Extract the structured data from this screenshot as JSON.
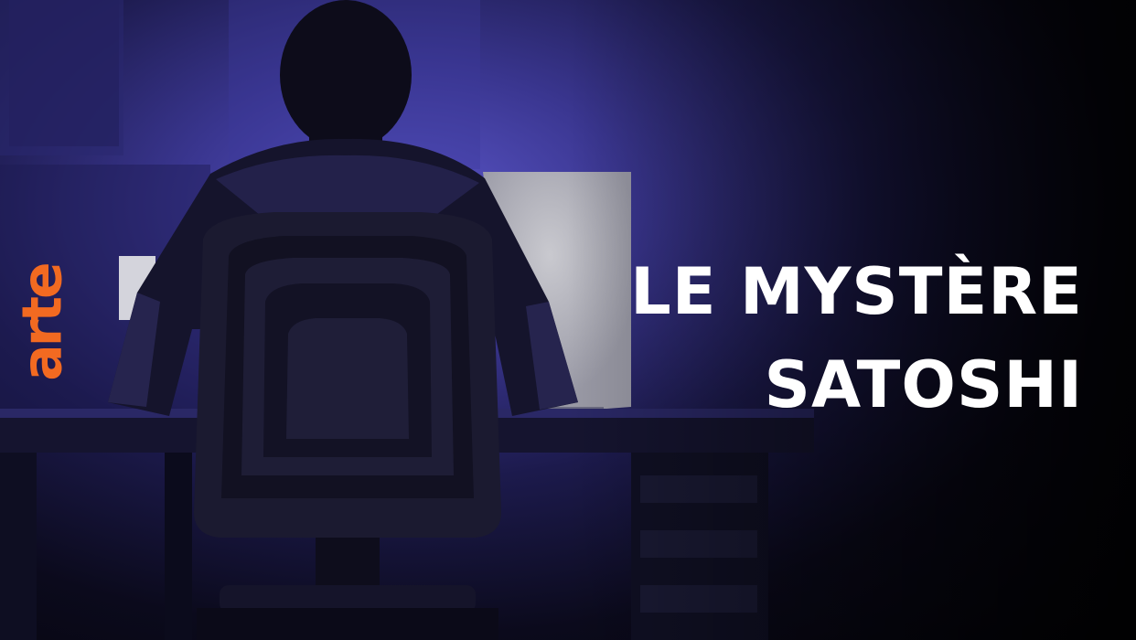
{
  "brand": {
    "logo_text": "arte",
    "logo_color": "#f26a21"
  },
  "title": {
    "line1": "LE MYSTÈRE",
    "line2": "SATOSHI"
  },
  "scene": {
    "description_icons": [
      "person-silhouette",
      "office-chair",
      "computer-monitor",
      "desk"
    ],
    "colors": {
      "glow": "#5a55c8",
      "shadow": "#040409",
      "screen": "#c9c9cf"
    }
  }
}
